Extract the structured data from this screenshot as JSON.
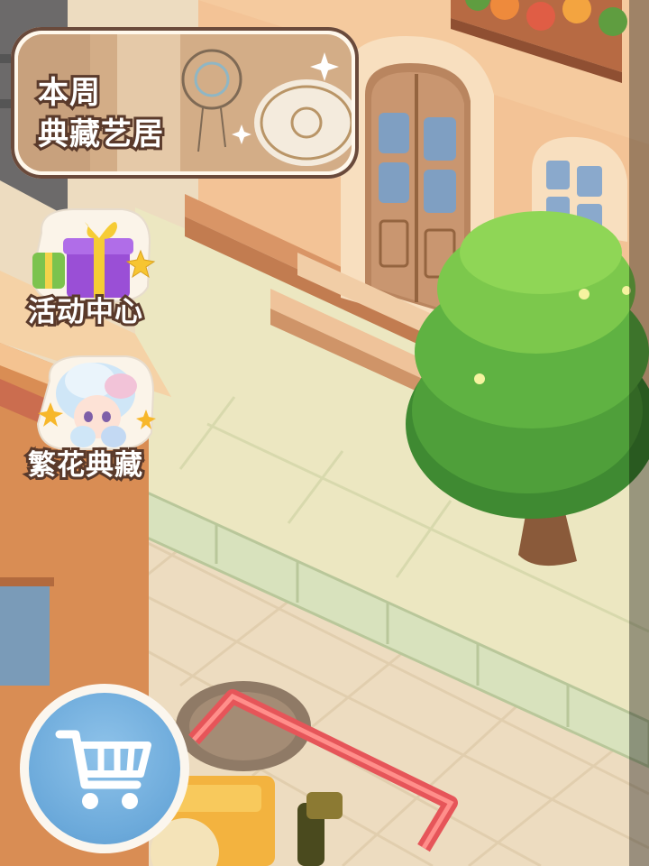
{
  "weekly_banner": {
    "line1": "本周",
    "line2": "典藏艺居"
  },
  "side_buttons": [
    {
      "id": "activity",
      "label": "活动中心",
      "icon": "gift-box-icon"
    },
    {
      "id": "flower",
      "label": "繁花典藏",
      "icon": "character-portrait-icon"
    }
  ],
  "cart_button": {
    "icon": "shopping-cart-icon"
  },
  "colors": {
    "text_outline": "#5a3a2b",
    "cart_blue": "#6ba9da",
    "tree_green": "#5fae3c"
  }
}
